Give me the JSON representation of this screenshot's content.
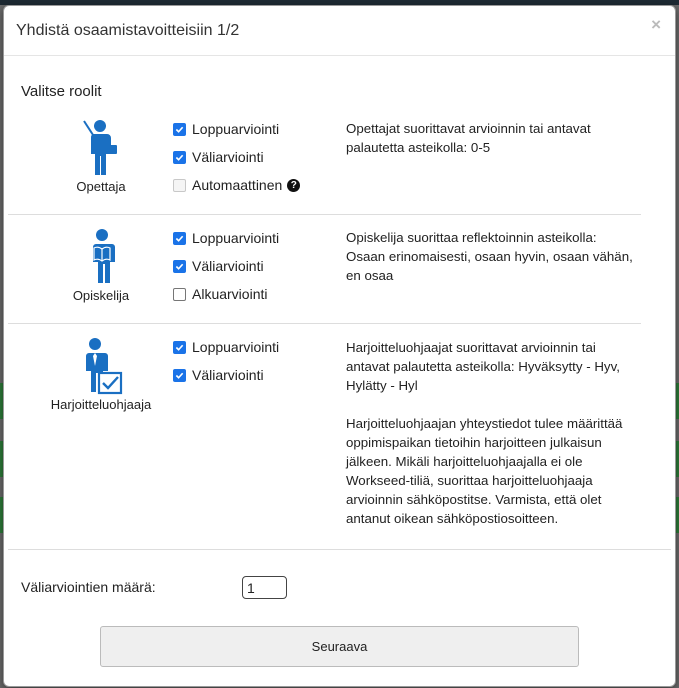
{
  "dialog": {
    "title": "Yhdistä osaamistavoitteisiin 1/2",
    "close": "×"
  },
  "section_title": "Valitse roolit",
  "roles": [
    {
      "name": "Opettaja",
      "options": [
        {
          "label": "Loppuarviointi",
          "checked": true,
          "disabled": false
        },
        {
          "label": "Väliarviointi",
          "checked": true,
          "disabled": false
        },
        {
          "label": "Automaattinen",
          "checked": false,
          "disabled": true
        }
      ],
      "description": "Opettajat suorittavat arvioinnin tai antavat palautetta asteikolla: 0-5"
    },
    {
      "name": "Opiskelija",
      "options": [
        {
          "label": "Loppuarviointi",
          "checked": true,
          "disabled": false
        },
        {
          "label": "Väliarviointi",
          "checked": true,
          "disabled": false
        },
        {
          "label": "Alkuarviointi",
          "checked": false,
          "disabled": false
        }
      ],
      "description": "Opiskelija suorittaa reflektoinnin asteikolla: Osaan erinomaisesti, osaan hyvin, osaan vähän, en osaa"
    },
    {
      "name": "Harjoitteluohjaaja",
      "options": [
        {
          "label": "Loppuarviointi",
          "checked": true,
          "disabled": false
        },
        {
          "label": "Väliarviointi",
          "checked": true,
          "disabled": false
        }
      ],
      "description": "Harjoitteluohjaajat suorittavat arvioinnin tai antavat palautetta asteikolla: Hyväksytty - Hyv, Hylätty - Hyl",
      "description2": "Harjoitteluohjaajan yhteystiedot tulee määrittää oppimispaikan tietoihin harjoitteen julkaisun jälkeen. Mikäli harjoitteluohjaajalla ei ole Workseed-tiliä, suorittaa harjoitteluohjaaja arvioinnin sähköpostitse. Varmista, että olet antanut oikean sähköpostiosoitteen."
    }
  ],
  "interim_count": {
    "label": "Väliarviointien määrä:",
    "value": "1"
  },
  "next_button": "Seuraava",
  "icon_color": "#1a6fc2"
}
